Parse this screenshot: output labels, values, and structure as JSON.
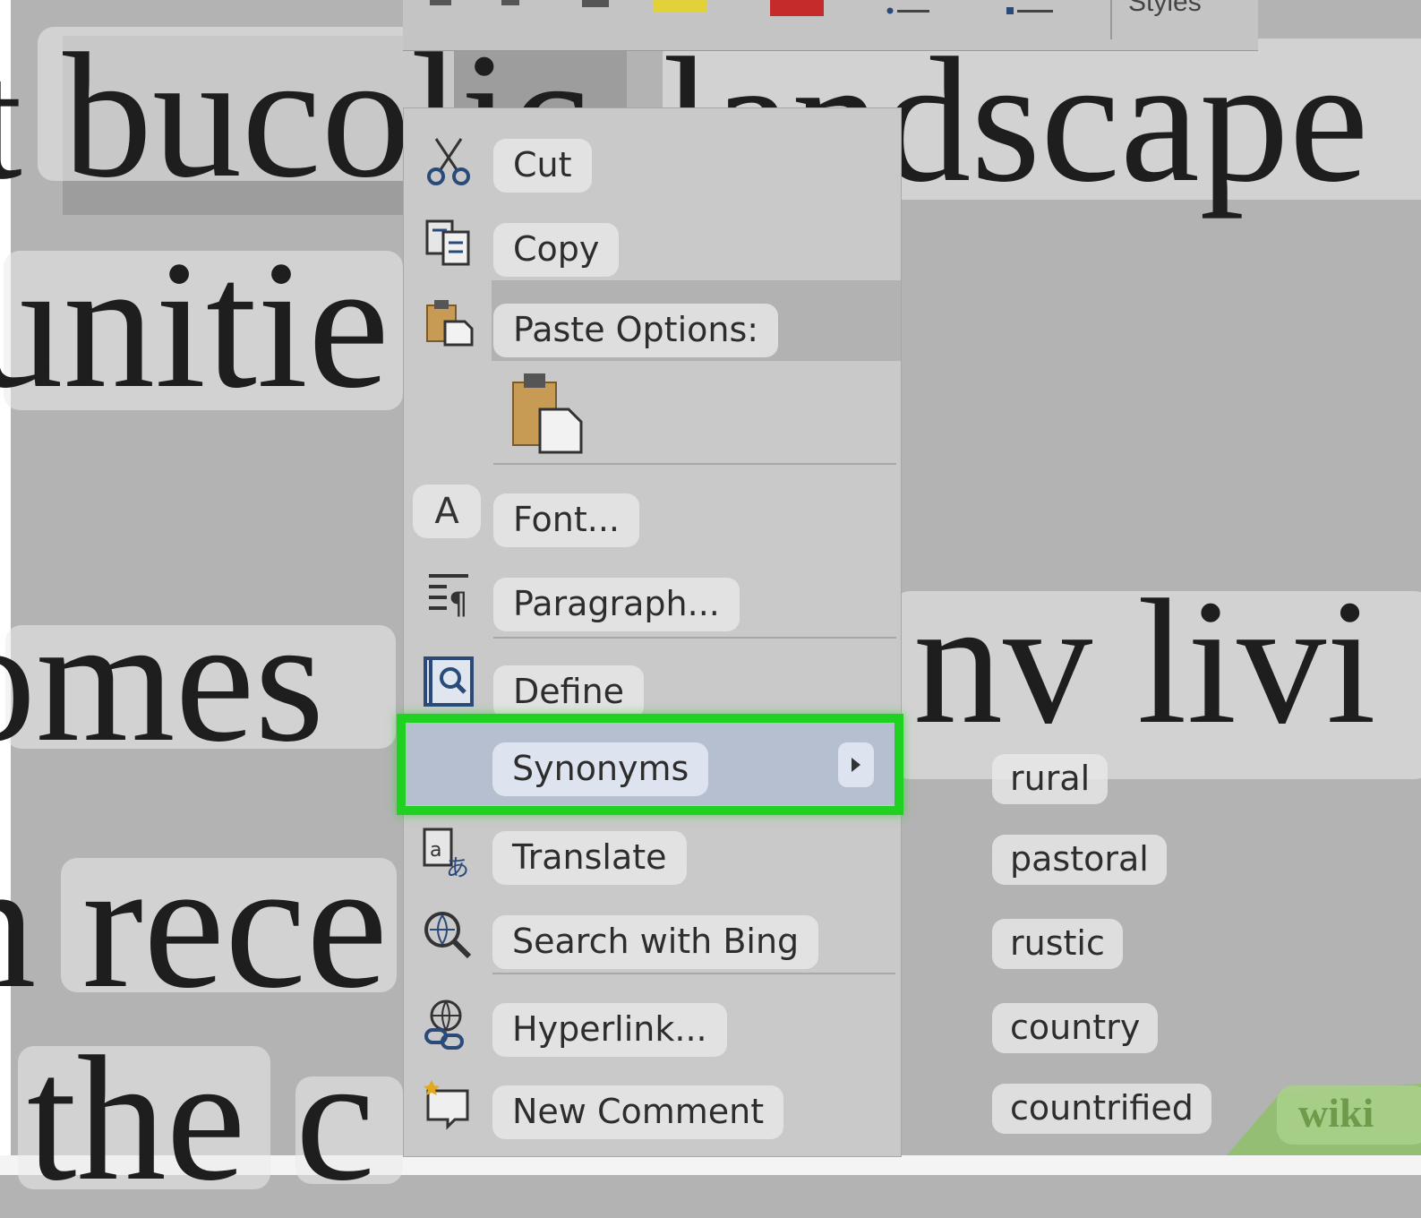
{
  "document": {
    "words": {
      "bucolic": "bucolic",
      "landscape": "landscape",
      "t_fragment": "t",
      "unities": "unitie",
      "omes": "omes",
      "nv_livi": "nv livi",
      "n_rece": "n rece",
      "the": "the",
      "c_fragment": "c"
    }
  },
  "toolbar": {
    "styles_label": "Styles"
  },
  "context_menu": {
    "items": [
      {
        "label": "Cut",
        "icon": "scissors-icon"
      },
      {
        "label": "Copy",
        "icon": "copy-icon"
      },
      {
        "label": "Paste Options:",
        "icon": "paste-icon"
      },
      {
        "label": "Font...",
        "icon": "font-icon",
        "icon_text": "A"
      },
      {
        "label": "Paragraph...",
        "icon": "paragraph-icon"
      },
      {
        "label": "Define",
        "icon": "define-icon"
      },
      {
        "label": "Synonyms",
        "icon": "",
        "has_submenu": true
      },
      {
        "label": "Translate",
        "icon": "translate-icon"
      },
      {
        "label": "Search with Bing",
        "icon": "search-icon"
      },
      {
        "label": "Hyperlink...",
        "icon": "hyperlink-icon"
      },
      {
        "label": "New Comment",
        "icon": "comment-icon"
      }
    ]
  },
  "synonyms": [
    "rural",
    "pastoral",
    "rustic",
    "country",
    "countrified"
  ],
  "watermark": "wiki",
  "colors": {
    "highlight": "#21d121",
    "synonyms_row": "#b6bfd0",
    "menu_bg": "#c9c9c9"
  }
}
